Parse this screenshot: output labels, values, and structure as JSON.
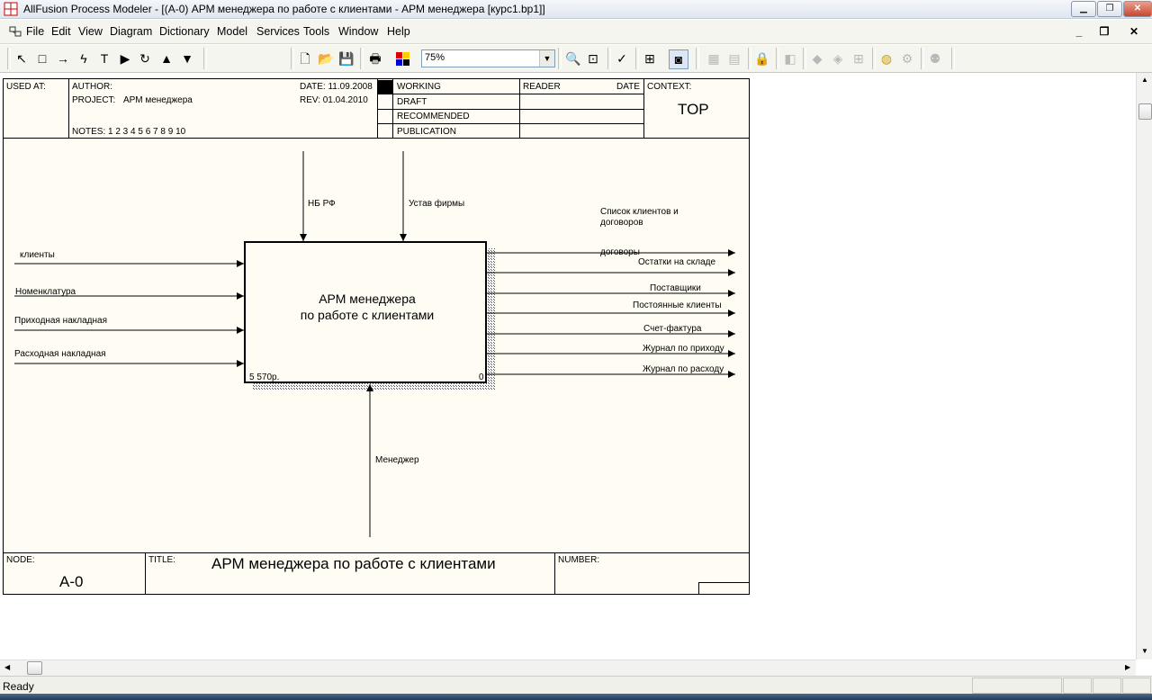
{
  "window": {
    "title": "AllFusion Process Modeler - [(A-0) АРМ менеджера  по работе с клиентами - АРМ менеджера  [курс1.bp1]]",
    "min": "▁",
    "restore": "❐",
    "close": "✕"
  },
  "menubar": {
    "items": [
      "File",
      "Edit",
      "View",
      "Diagram",
      "Dictionary",
      "Model",
      "Services",
      "Tools",
      "Window",
      "Help"
    ],
    "mdi_min": "_",
    "mdi_restore": "❐",
    "mdi_close": "✕"
  },
  "toolbar": {
    "zoom_value": "75%",
    "tools": [
      "pointer-icon",
      "box-icon",
      "arrow-icon",
      "squiggle-icon",
      "text-icon",
      "triangle-right-icon",
      "undo-icon",
      "up-icon",
      "down-icon"
    ],
    "glyphs": {
      "pointer": "↖",
      "box": "□",
      "arrow": "→",
      "squiggle": "ϟ",
      "text": "T",
      "play": "▶",
      "rotate": "↻",
      "up": "▲",
      "down": "▼",
      "new": "🗋",
      "open": "📂",
      "save": "💾",
      "print": "🖶",
      "zoomin": "🔍",
      "zoomfit": "⊡",
      "spell": "✓",
      "tree": "⊞",
      "model": "◙",
      "dd": "▼"
    }
  },
  "header": {
    "used_at": "USED AT:",
    "author": "AUTHOR:",
    "project_label": "PROJECT:",
    "project": "АРМ менеджера",
    "notes": "NOTES:  1  2  3  4  5  6  7  8  9  10",
    "date": "DATE: 11.09.2008",
    "rev": "REV:   01.04.2010",
    "status": [
      "WORKING",
      "DRAFT",
      "RECOMMENDED",
      "PUBLICATION"
    ],
    "reader": "READER",
    "date_col": "DATE",
    "context": "CONTEXT:",
    "context_value": "TOP"
  },
  "diagram": {
    "box_title_1": "АРМ менеджера",
    "box_title_2": "по работе с клиентами",
    "cost": "5 570р.",
    "box_num": "0",
    "controls": [
      "НБ РФ",
      "Устав фирмы"
    ],
    "inputs": [
      "клиенты",
      "Номенклатура",
      "Приходная накладная",
      "Расходная накладная"
    ],
    "mechanism": "Менеджер",
    "outputs_header_1": "Список клиентов и",
    "outputs_header_2": "договоров",
    "outputs": [
      "договоры",
      "Остатки на складе",
      "Поставщики",
      "Постоянные клиенты",
      "Счет-фактура",
      "Журнал по приходу",
      "Журнал по расходу"
    ]
  },
  "footer": {
    "node_label": "NODE:",
    "node": "A-0",
    "title_label": "TITLE:",
    "title": "АРМ менеджера  по работе с клиентами",
    "number_label": "NUMBER:"
  },
  "status": {
    "text": "Ready"
  },
  "colors": {
    "diagram_bg": "#fffdf3",
    "title_gradient": "#dfe6ef",
    "close_btn": "#c8462e"
  }
}
